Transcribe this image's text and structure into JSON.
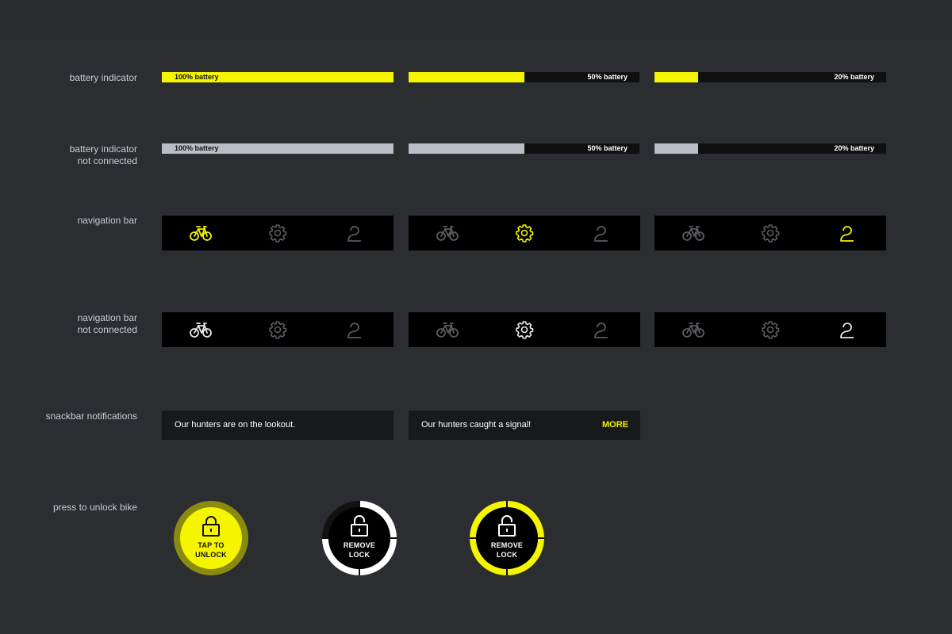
{
  "labels": {
    "battery_indicator": "battery indicator",
    "battery_nc_line1": "battery indicator",
    "battery_nc_line2": "not connected",
    "navigation_bar": "navigation bar",
    "nav_nc_line1": "navigation bar",
    "nav_nc_line2": "not connected",
    "snackbar": "snackbar notifications",
    "unlock": "press to unlock bike"
  },
  "battery": [
    {
      "label": "100% battery",
      "level": 1.0
    },
    {
      "label": "50% battery",
      "level": 0.5
    },
    {
      "label": "20% battery",
      "level": 0.19
    }
  ],
  "battery_not_connected": [
    {
      "label": "100% battery",
      "level": 1.0
    },
    {
      "label": "50% battery",
      "level": 0.5
    },
    {
      "label": "20% battery",
      "level": 0.19
    }
  ],
  "nav_bars": [
    {
      "active": "bike-icon"
    },
    {
      "active": "settings-icon"
    },
    {
      "active": "profile-icon"
    }
  ],
  "nav_bars_not_connected": [
    {
      "active": "bike-icon"
    },
    {
      "active": "settings-icon"
    },
    {
      "active": "profile-icon"
    }
  ],
  "snackbars": [
    {
      "message": "Our hunters are on the lookout.",
      "action": ""
    },
    {
      "message": "Our hunters caught a signal!",
      "action": "MORE"
    }
  ],
  "lock_buttons": [
    {
      "line1": "TAP TO",
      "line2": "UNLOCK",
      "state": "locked"
    },
    {
      "line1": "REMOVE",
      "line2": "LOCK",
      "state": "progress-white"
    },
    {
      "line1": "REMOVE",
      "line2": "LOCK",
      "state": "progress-yellow"
    }
  ],
  "colors": {
    "background": "#2b2d30",
    "accent_yellow": "#f5f500",
    "disconnected_grey": "#b9bec6",
    "bar_track": "#101010",
    "icon_inactive": "#5a5c60",
    "icon_active_nc": "#e8e8e8"
  }
}
